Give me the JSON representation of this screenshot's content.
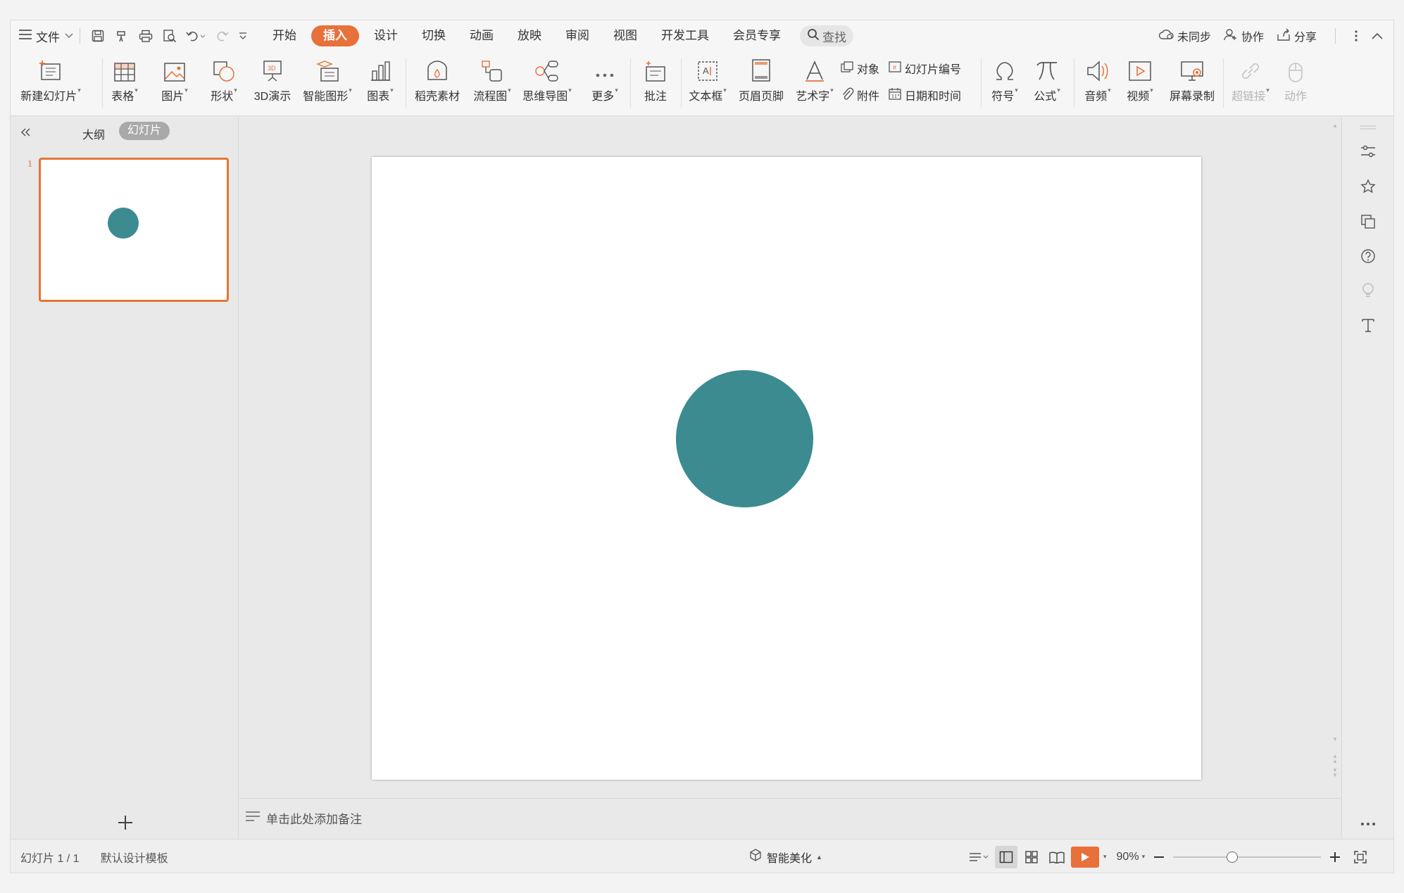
{
  "menubar": {
    "file_label": "文件",
    "tabs": [
      {
        "label": "开始"
      },
      {
        "label": "插入"
      },
      {
        "label": "设计"
      },
      {
        "label": "切换"
      },
      {
        "label": "动画"
      },
      {
        "label": "放映"
      },
      {
        "label": "审阅"
      },
      {
        "label": "视图"
      },
      {
        "label": "开发工具"
      },
      {
        "label": "会员专享"
      }
    ],
    "active_tab": "插入",
    "search_label": "查找",
    "sync_label": "未同步",
    "collab_label": "协作",
    "share_label": "分享"
  },
  "ribbon": {
    "new_slide": "新建幻灯片",
    "table": "表格",
    "picture": "图片",
    "shape": "形状",
    "threed": "3D演示",
    "smartart": "智能图形",
    "chart": "图表",
    "daoke": "稻壳素材",
    "flowchart": "流程图",
    "mindmap": "思维导图",
    "more": "更多",
    "comment": "批注",
    "textbox": "文本框",
    "header_footer": "页眉页脚",
    "wordart": "艺术字",
    "object": "对象",
    "attachment": "附件",
    "slide_number": "幻灯片编号",
    "datetime": "日期和时间",
    "symbol": "符号",
    "formula": "公式",
    "audio": "音频",
    "video": "视频",
    "screen_record": "屏幕录制",
    "hyperlink": "超链接",
    "action": "动作"
  },
  "left_panel": {
    "tab_outline": "大纲",
    "tab_slides": "幻灯片",
    "slide_number": "1"
  },
  "notes": {
    "placeholder": "单击此处添加备注"
  },
  "statusbar": {
    "slide_info": "幻灯片 1 / 1",
    "template": "默认设计模板",
    "beautify": "智能美化",
    "zoom": "90%"
  },
  "slide": {
    "shape": "circle",
    "fill_color": "#3b8b91"
  },
  "colors": {
    "accent": "#e8703a",
    "circle": "#3b8b91"
  }
}
